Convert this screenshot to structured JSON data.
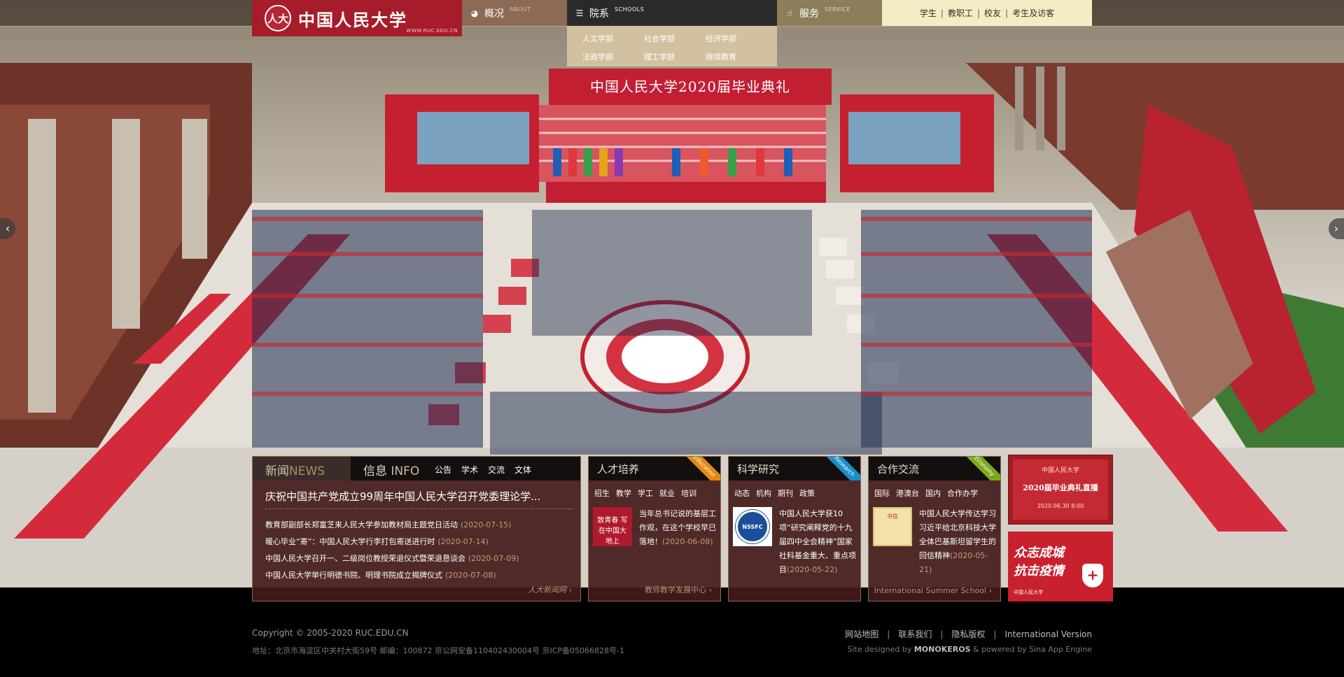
{
  "logo": {
    "seal_text": "人大",
    "name": "中国人民大学",
    "url": "WWW.RUC.EDU.CN"
  },
  "nav": {
    "about": {
      "cn": "概况",
      "en": "ABOUT"
    },
    "schools": {
      "cn": "院系",
      "en": "SCHOOLS"
    },
    "service": {
      "cn": "服务",
      "en": "SERVICE"
    },
    "audience_links": [
      "学生",
      "教职工",
      "校友",
      "考生及访客"
    ]
  },
  "schools_dropdown": [
    "人文学部",
    "社会学部",
    "经济学部",
    "法政学部",
    "理工学部",
    "继续教育"
  ],
  "hero": {
    "ceremony_banner": "中国人民大学2020届毕业典礼"
  },
  "news": {
    "tab_news_cn": "新闻",
    "tab_news_en": "NEWS",
    "tab_info_cn": "信息",
    "tab_info_en": "INFO",
    "info_sub": [
      "公告",
      "学术",
      "交流",
      "文体"
    ],
    "headline": "庆祝中国共产党成立99周年中国人民大学召开党委理论学...",
    "items": [
      {
        "title": "教育部副部长郑富芝来人民大学参加教材局主题党日活动",
        "date": "(2020-07-15)"
      },
      {
        "title": "暖心毕业“寄”：中国人民大学行李打包寄送进行时",
        "date": "(2020-07-14)"
      },
      {
        "title": "中国人民大学召开一、二级岗位教授荣退仪式暨荣退恳谈会",
        "date": "(2020-07-09)"
      },
      {
        "title": "中国人民大学举行明德书院、明理书院成立揭牌仪式",
        "date": "(2020-07-08)"
      }
    ],
    "more": "人大新闻网 ›"
  },
  "talent": {
    "title": "人才培养",
    "ribbon": "Education",
    "sub": [
      "招生",
      "教学",
      "学工",
      "就业",
      "培训"
    ],
    "thumb_text": "致青春 写在中国大地上",
    "text": "当年总书记说的基层工作观，在这个学校早已落地！",
    "date": "(2020-06-08)",
    "more": "教师教学发展中心 ›"
  },
  "research": {
    "title": "科学研究",
    "ribbon": "Research",
    "sub": [
      "动态",
      "机构",
      "期刊",
      "政策"
    ],
    "thumb_text": "NSSFC",
    "text": "中国人民大学获10项“研究阐释党的十九届四中全会精神”国家社科基金重大、重点项目",
    "date": "(2020-05-22)"
  },
  "cooperation": {
    "title": "合作交流",
    "ribbon": "Economy",
    "sub": [
      "国际",
      "港澳台",
      "国内",
      "合作办学"
    ],
    "thumb_text": "书信",
    "text": "中国人民大学传达学习习近平给北京科技大学全体巴基斯坦留学生的回信精神",
    "date": "(2020-05-21)",
    "more": "International Summer School ›"
  },
  "promo_live": {
    "line1": "中国人民大学",
    "line2": "2020届毕业典礼直播",
    "line3": "2020.06.30 8:00"
  },
  "promo_covid": {
    "line1": "众志成城",
    "line2": "抗击疫情",
    "footer": "中国人民大学"
  },
  "footer": {
    "copyright": "Copyright © 2005-2020 RUC.EDU.CN",
    "address": "地址：北京市海淀区中关村大街59号 邮编：100872 京公网安备110402430004号 京ICP备05066828号-1",
    "links": [
      "网站地图",
      "联系我们",
      "隐私版权",
      "International Version"
    ],
    "credits_prefix": "Site designed by ",
    "credits_brand": "MONOKEROS",
    "credits_suffix": " & powered by Sina App Engine"
  },
  "colors": {
    "brand_red": "#a61c2b",
    "panel_bg": "#431b1a",
    "gold_link": "#c69b76",
    "edu_orange": "#e2890f",
    "research_blue": "#1c8ec9",
    "economy_green": "#7da81d"
  }
}
